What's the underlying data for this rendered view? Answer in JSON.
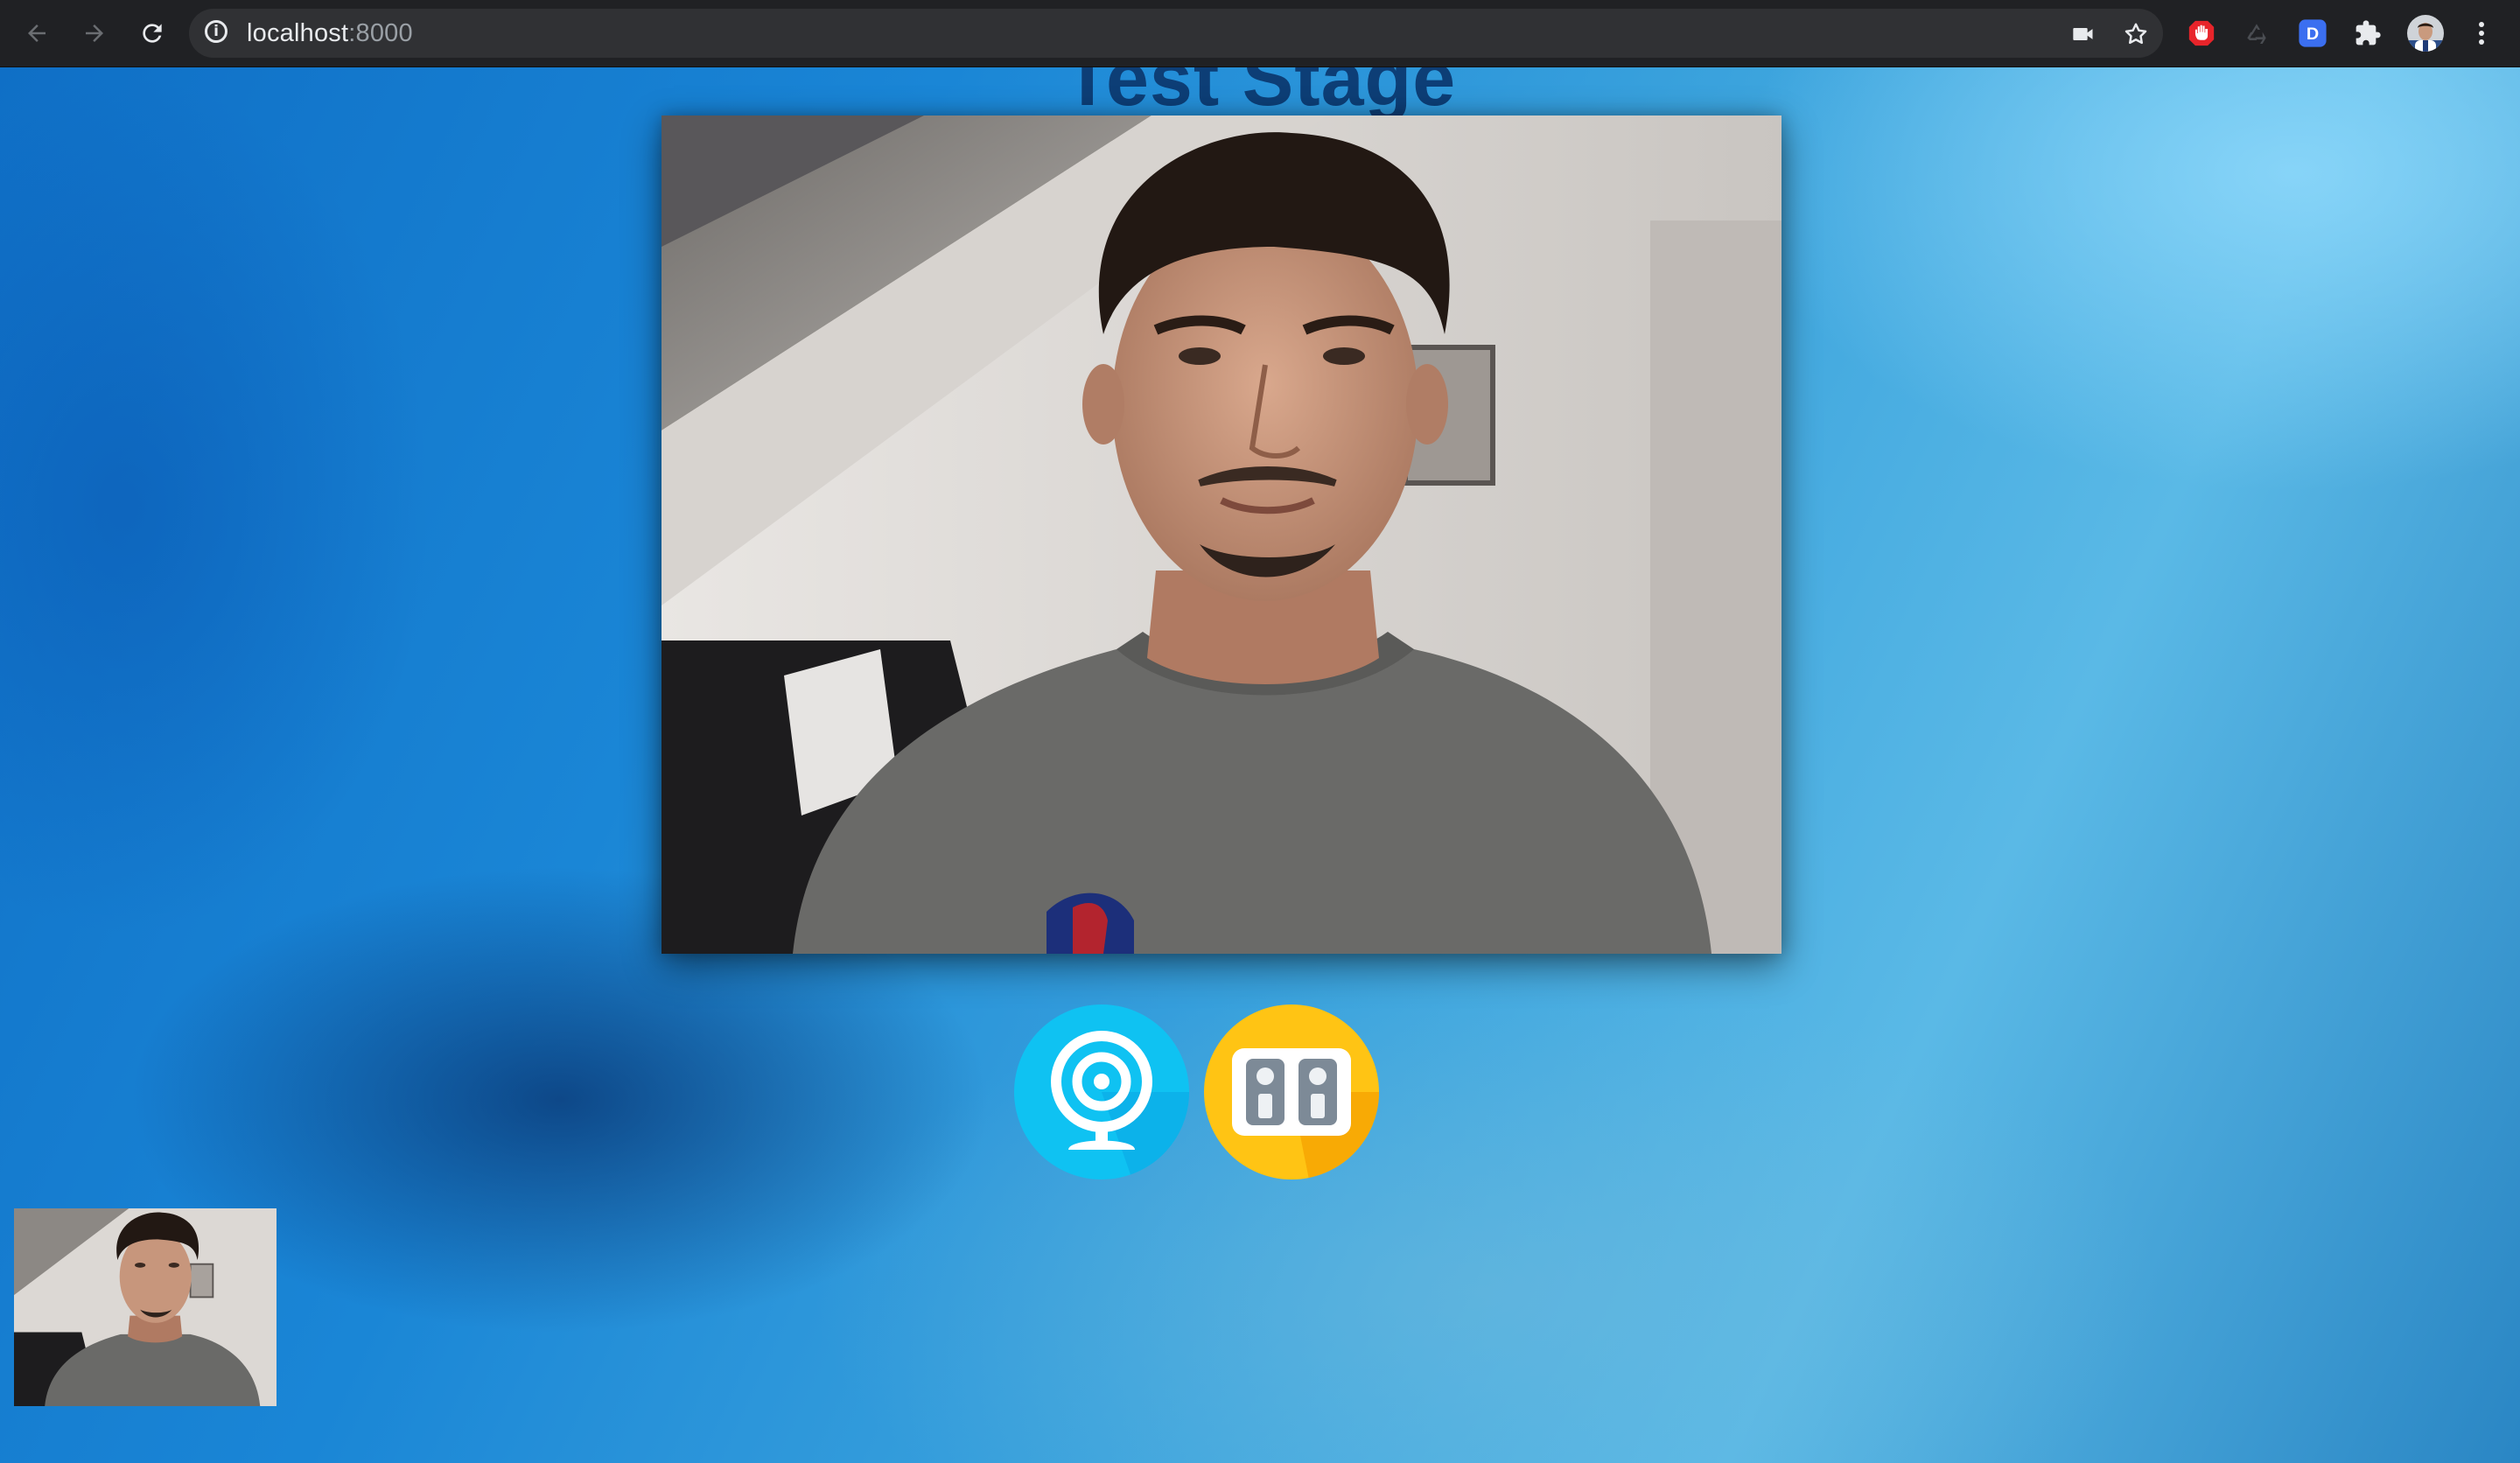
{
  "browser": {
    "url_host": "localhost",
    "url_port": ":8000",
    "extensions": [
      {
        "name": "camera-icon"
      },
      {
        "name": "bookmark-star-icon"
      },
      {
        "name": "stop-hand-extension-icon",
        "color": "#e8242a"
      },
      {
        "name": "recycle-extension-icon"
      },
      {
        "name": "d-extension-icon",
        "label": "D",
        "color": "#3b6ff0"
      },
      {
        "name": "puzzle-extensions-icon"
      },
      {
        "name": "profile-avatar"
      },
      {
        "name": "kebab-menu-icon"
      }
    ]
  },
  "page": {
    "title": "Test Stage",
    "controls": [
      {
        "name": "webcam-toggle-button",
        "icon": "webcam-icon",
        "color": "#0fc2f2"
      },
      {
        "name": "speakers-toggle-button",
        "icon": "speakers-icon",
        "color": "#ffc414"
      }
    ]
  }
}
